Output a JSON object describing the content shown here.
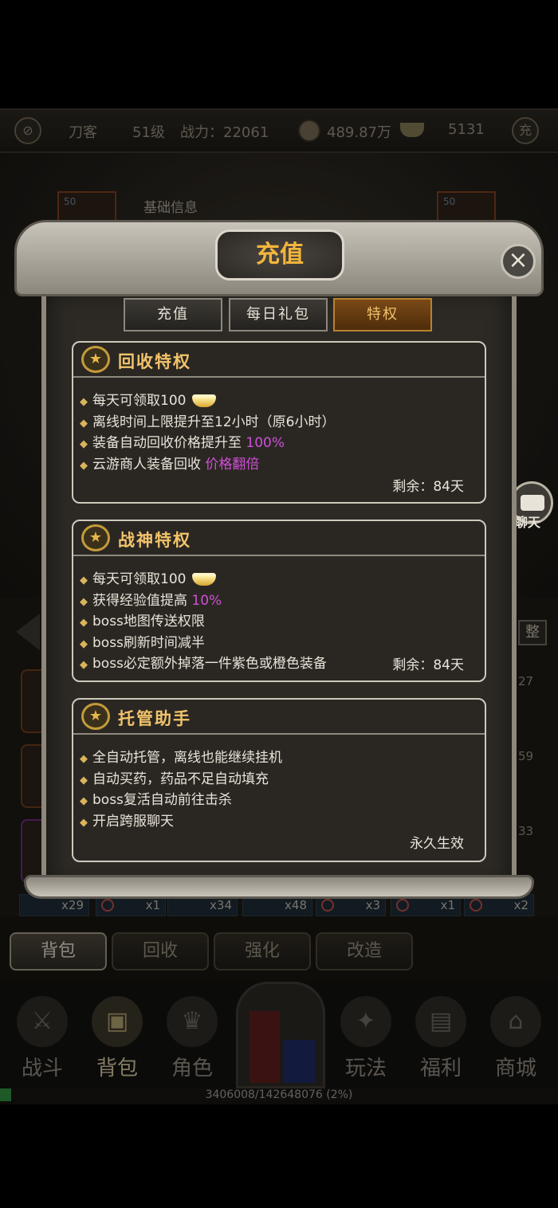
{
  "topbar": {
    "player_name": "刀客",
    "level": "51级",
    "power": "战力：22061",
    "copper": "489.87万",
    "gold": "5131",
    "recharge_icon_text": "充"
  },
  "scene": {
    "base_info": "基础信息",
    "player_name_overlay": "刀客",
    "slot_left_level": "50",
    "slot_right_level": "50"
  },
  "bag": {
    "sort_button": "整",
    "side_numbers": [
      "27",
      "59",
      "33"
    ],
    "counts": [
      "x29",
      "x1",
      "x34",
      "x48",
      "x3",
      "x1",
      "x2"
    ]
  },
  "bottom_tabs": [
    "背包",
    "回收",
    "强化",
    "改造"
  ],
  "nav": {
    "items": [
      "战斗",
      "背包",
      "角色",
      "玩法",
      "福利",
      "商城"
    ]
  },
  "exp": {
    "text": "3406008/142648076 (2%)",
    "percent": 2
  },
  "chat": {
    "label": "聊天"
  },
  "modal": {
    "title": "充值",
    "close": "×",
    "tabs": [
      "充值",
      "每日礼包",
      "特权"
    ],
    "active_tab": "特权",
    "cards": [
      {
        "title": "回收特权",
        "lines": [
          {
            "text": "每天可领取100",
            "hl": "",
            "ingot": true
          },
          {
            "text": "离线时间上限提升至12小时（原6小时）",
            "hl": "",
            "ingot": false
          },
          {
            "text": "装备自动回收价格提升至 ",
            "hl": "100%",
            "ingot": false
          },
          {
            "text": "云游商人装备回收 ",
            "hl": "价格翻倍",
            "ingot": false
          }
        ],
        "remaining": "剩余：84天"
      },
      {
        "title": "战神特权",
        "lines": [
          {
            "text": "每天可领取100",
            "hl": "",
            "ingot": true
          },
          {
            "text": "获得经验值提高 ",
            "hl": "10%",
            "ingot": false
          },
          {
            "text": "boss地图传送权限",
            "hl": "",
            "ingot": false
          },
          {
            "text": "boss刷新时间减半",
            "hl": "",
            "ingot": false
          },
          {
            "text": "boss必定额外掉落一件紫色或橙色装备",
            "hl": "",
            "ingot": false
          }
        ],
        "remaining": "剩余：84天"
      },
      {
        "title": "托管助手",
        "lines": [
          {
            "text": "全自动托管，离线也能继续挂机",
            "hl": "",
            "ingot": false
          },
          {
            "text": "自动买药，药品不足自动填充",
            "hl": "",
            "ingot": false
          },
          {
            "text": "boss复活自动前往击杀",
            "hl": "",
            "ingot": false
          },
          {
            "text": "开启跨服聊天",
            "hl": "",
            "ingot": false
          }
        ],
        "remaining": "永久生效"
      }
    ]
  },
  "colors": {
    "accent_gold": "#f2c36a",
    "highlight_purple": "#d04fd6",
    "active_tab": "#7a4a17",
    "exp_green": "#2e8a3e"
  }
}
